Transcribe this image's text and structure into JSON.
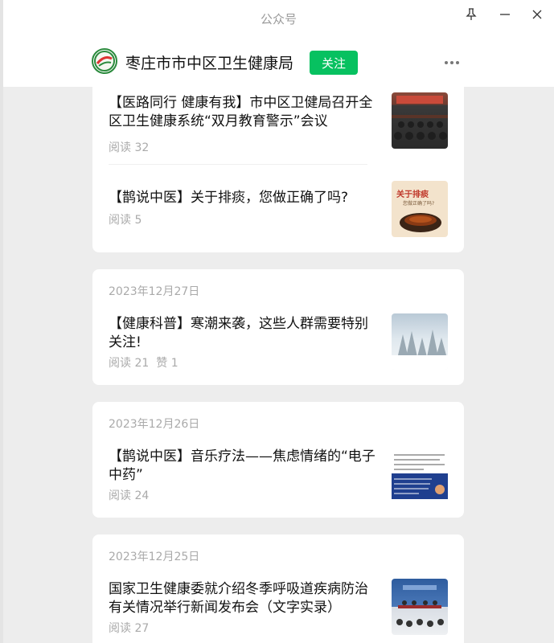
{
  "window": {
    "title": "公众号"
  },
  "account": {
    "name": "枣庄市市中区卫生健康局",
    "follow_label": "关注"
  },
  "feed": {
    "card1": {
      "articles": [
        {
          "title": "【医路同行 健康有我】市中区卫健局召开全区卫生健康系统“双月教育警示”会议",
          "read_label": "阅读 32"
        },
        {
          "title": "【鹊说中医】关于排痰，您做正确了吗?",
          "read_label": "阅读 5",
          "thumb_text_1": "关于排痰",
          "thumb_text_2": "您做正确了吗?"
        }
      ]
    },
    "card2": {
      "date": "2023年12月27日",
      "article": {
        "title": "【健康科普】寒潮来袭，这些人群需要特别关注!",
        "read_label": "阅读 21",
        "like_label": "赞 1"
      }
    },
    "card3": {
      "date": "2023年12月26日",
      "article": {
        "title": "【鹊说中医】音乐疗法——焦虑情绪的“电子中药”",
        "read_label": "阅读 24"
      }
    },
    "card4": {
      "date": "2023年12月25日",
      "article": {
        "title": "国家卫生健康委就介绍冬季呼吸道疾病防治有关情况举行新闻发布会（文字实录）",
        "read_label": "阅读 27"
      }
    }
  },
  "colors": {
    "follow_button": "#07c160",
    "background": "#ededed",
    "meta_text": "#aaaaaa"
  },
  "icons": {
    "pin": "pin-icon",
    "minimize": "minimize-icon",
    "close": "close-icon",
    "more": "more-dots-icon",
    "logo": "account-logo"
  }
}
